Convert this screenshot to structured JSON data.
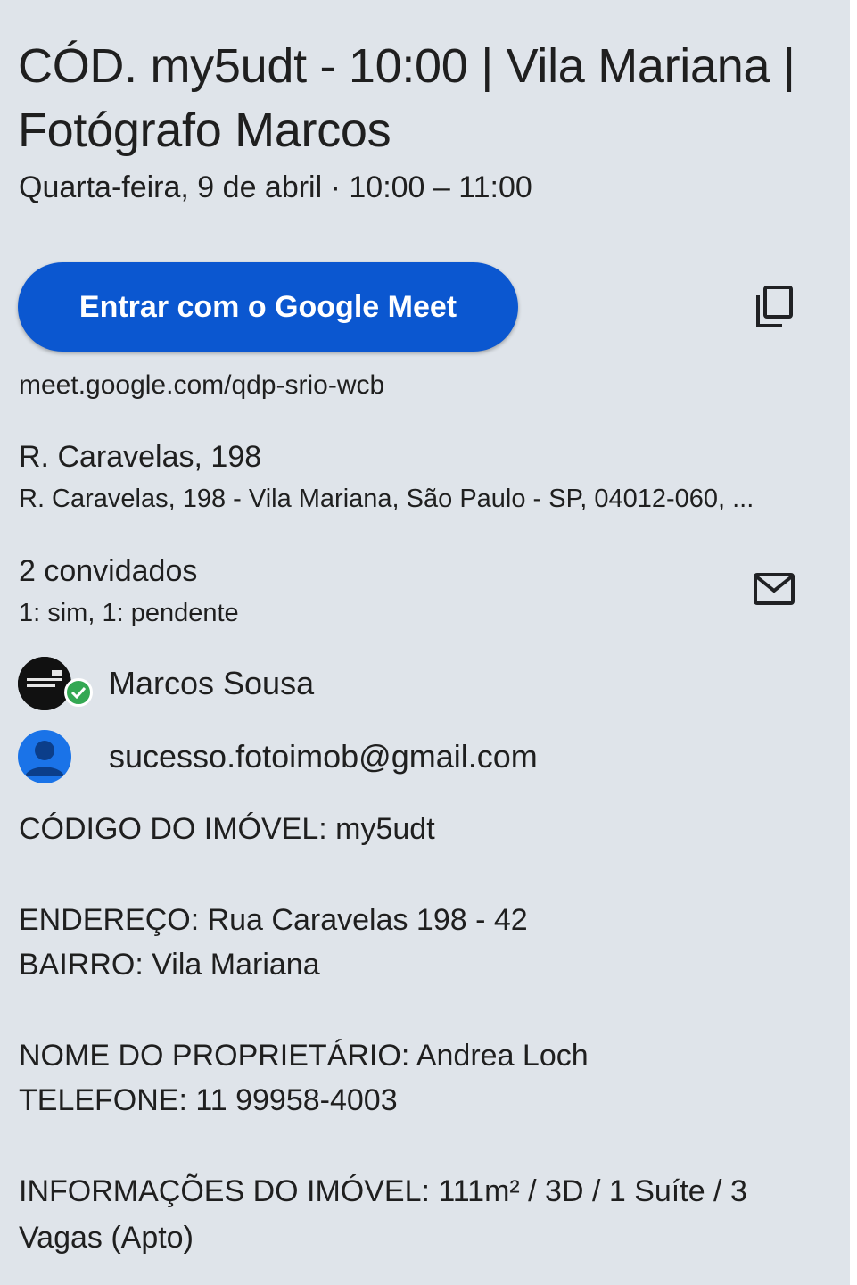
{
  "event": {
    "title": "CÓD. my5udt - 10:00 | Vila Mariana | Fotógrafo Marcos",
    "date_time": "Quarta-feira, 9 de abril  ·  10:00 – 11:00"
  },
  "meet": {
    "join_label": "Entrar com o Google Meet",
    "link": "meet.google.com/qdp-srio-wcb",
    "copy_icon": "copy-icon"
  },
  "location": {
    "name": "R. Caravelas, 198",
    "full": "R. Caravelas, 198 - Vila Mariana, São Paulo - SP, 04012-060, ..."
  },
  "guests": {
    "count": "2 convidados",
    "status": "1: sim, 1: pendente",
    "email_icon": "mail-icon",
    "list": [
      {
        "name": "Marcos Sousa",
        "avatar": "logo-avatar",
        "accepted": true
      },
      {
        "name": "sucesso.fotoimob@gmail.com",
        "avatar": "person-icon",
        "accepted": false
      }
    ]
  },
  "description": {
    "code": "CÓDIGO DO IMÓVEL: my5udt",
    "address": "ENDEREÇO: Rua Caravelas 198 - 42",
    "neighborhood": "BAIRRO: Vila Mariana",
    "owner": "NOME DO PROPRIETÁRIO: Andrea Loch",
    "phone": "TELEFONE:  11 99958-4003",
    "info_line1": "INFORMAÇÕES DO IMÓVEL: 111m² / 3D / 1 Suíte / 3",
    "info_line2": "Vagas (Apto)"
  },
  "colors": {
    "background": "#dfe4ea",
    "button": "#0b57d0",
    "accepted_badge": "#34a853",
    "person_avatar": "#1a73e8"
  }
}
